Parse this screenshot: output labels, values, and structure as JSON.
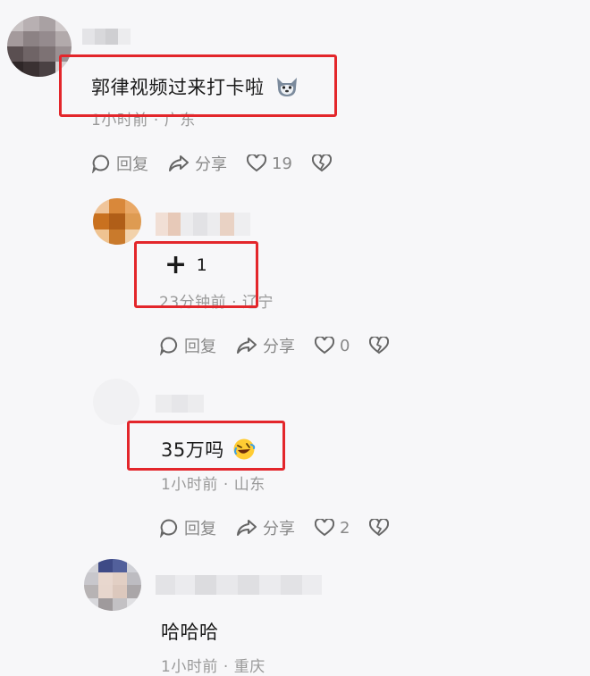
{
  "comments": [
    {
      "content": "郭律视频过来打卡啦",
      "emoji": "wolf-face-emoji",
      "time": "1小时前",
      "location": "广东",
      "actions": {
        "reply": "回复",
        "share": "分享",
        "likes": "19"
      }
    },
    {
      "content_symbol": "+",
      "content_text": "1",
      "time": "23分钟前",
      "location": "辽宁",
      "actions": {
        "reply": "回复",
        "share": "分享",
        "likes": "0"
      }
    },
    {
      "content": "35万吗",
      "emoji": "rolling-on-floor-laughing-emoji",
      "time": "1小时前",
      "location": "山东",
      "actions": {
        "reply": "回复",
        "share": "分享",
        "likes": "2"
      }
    },
    {
      "content": "哈哈哈",
      "time": "1小时前",
      "location": "重庆"
    }
  ],
  "meta_separator": "·",
  "colors": {
    "highlight": "#e3262b",
    "meta": "#999999",
    "background": "#f7f7f9"
  }
}
